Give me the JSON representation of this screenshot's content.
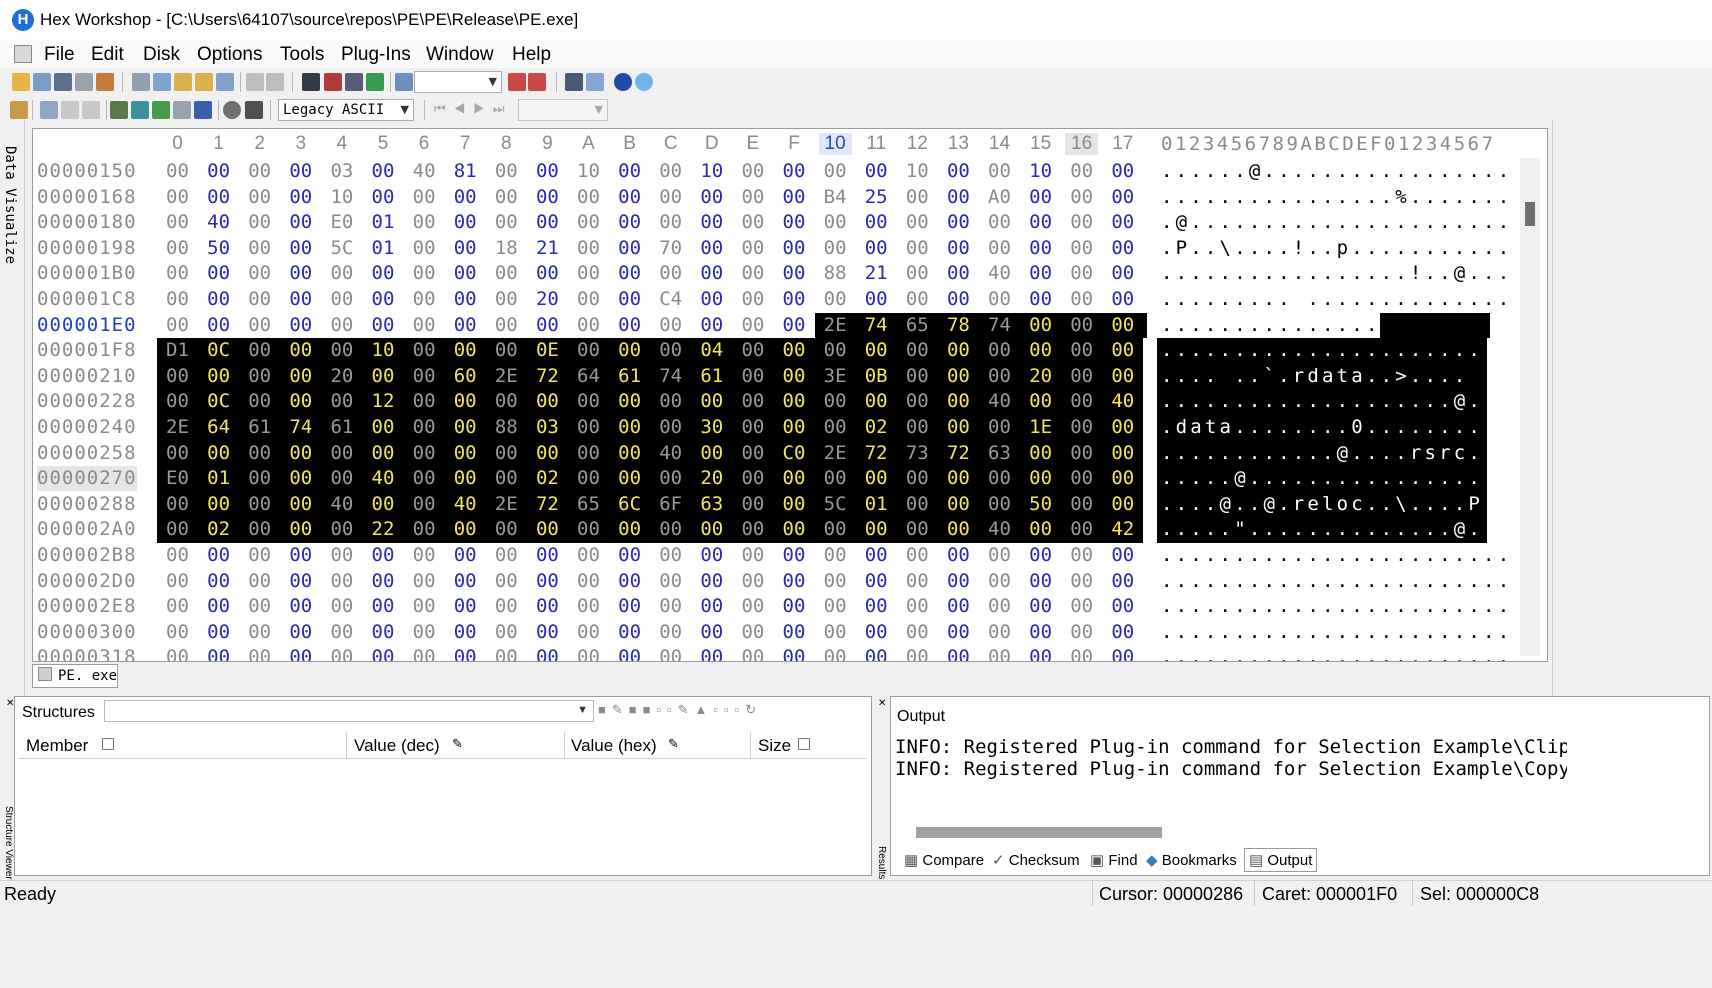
{
  "window": {
    "title": "Hex Workshop - [C:\\Users\\64107\\source\\repos\\PE\\PE\\Release\\PE.exe]",
    "icon": "hex-workshop-logo"
  },
  "menu": [
    "File",
    "Edit",
    "Disk",
    "Options",
    "Tools",
    "Plug-Ins",
    "Window",
    "Help"
  ],
  "toolbar2": {
    "encoding": "Legacy ASCII"
  },
  "side_tabs": {
    "left": "Data Visualize",
    "structure": "Structure Viewer",
    "results": "Results"
  },
  "editor": {
    "columns": [
      "0",
      "1",
      "2",
      "3",
      "4",
      "5",
      "6",
      "7",
      "8",
      "9",
      "A",
      "B",
      "C",
      "D",
      "E",
      "F",
      "10",
      "11",
      "12",
      "13",
      "14",
      "15",
      "16",
      "17"
    ],
    "ascii_header": "0123456789ABCDEF01234567",
    "rows": [
      {
        "addr": "00000150",
        "bytes": [
          "00",
          "00",
          "00",
          "00",
          "03",
          "00",
          "40",
          "81",
          "00",
          "00",
          "10",
          "00",
          "00",
          "10",
          "00",
          "00",
          "00",
          "00",
          "10",
          "00",
          "00",
          "10",
          "00",
          "00"
        ],
        "ascii": "......@................."
      },
      {
        "addr": "00000168",
        "bytes": [
          "00",
          "00",
          "00",
          "00",
          "10",
          "00",
          "00",
          "00",
          "00",
          "00",
          "00",
          "00",
          "00",
          "00",
          "00",
          "00",
          "B4",
          "25",
          "00",
          "00",
          "A0",
          "00",
          "00",
          "00"
        ],
        "ascii": "................%......."
      },
      {
        "addr": "00000180",
        "bytes": [
          "00",
          "40",
          "00",
          "00",
          "E0",
          "01",
          "00",
          "00",
          "00",
          "00",
          "00",
          "00",
          "00",
          "00",
          "00",
          "00",
          "00",
          "00",
          "00",
          "00",
          "00",
          "00",
          "00",
          "00"
        ],
        "ascii": ".@......................"
      },
      {
        "addr": "00000198",
        "bytes": [
          "00",
          "50",
          "00",
          "00",
          "5C",
          "01",
          "00",
          "00",
          "18",
          "21",
          "00",
          "00",
          "70",
          "00",
          "00",
          "00",
          "00",
          "00",
          "00",
          "00",
          "00",
          "00",
          "00",
          "00"
        ],
        "ascii": ".P..\\....!..p..........."
      },
      {
        "addr": "000001B0",
        "bytes": [
          "00",
          "00",
          "00",
          "00",
          "00",
          "00",
          "00",
          "00",
          "00",
          "00",
          "00",
          "00",
          "00",
          "00",
          "00",
          "00",
          "88",
          "21",
          "00",
          "00",
          "40",
          "00",
          "00",
          "00"
        ],
        "ascii": ".................!..@..."
      },
      {
        "addr": "000001C8",
        "bytes": [
          "00",
          "00",
          "00",
          "00",
          "00",
          "00",
          "00",
          "00",
          "00",
          "20",
          "00",
          "00",
          "C4",
          "00",
          "00",
          "00",
          "00",
          "00",
          "00",
          "00",
          "00",
          "00",
          "00",
          "00"
        ],
        "ascii": "......... .............."
      },
      {
        "addr": "000001E0",
        "bytes": [
          "00",
          "00",
          "00",
          "00",
          "00",
          "00",
          "00",
          "00",
          "00",
          "00",
          "00",
          "00",
          "00",
          "00",
          "00",
          "00",
          "2E",
          "74",
          "65",
          "78",
          "74",
          "00",
          "00",
          "00"
        ],
        "ascii": "................text..."
      },
      {
        "addr": "000001F8",
        "bytes": [
          "D1",
          "0C",
          "00",
          "00",
          "00",
          "10",
          "00",
          "00",
          "00",
          "0E",
          "00",
          "00",
          "00",
          "04",
          "00",
          "00",
          "00",
          "00",
          "00",
          "00",
          "00",
          "00",
          "00",
          "00"
        ],
        "ascii": "........................"
      },
      {
        "addr": "00000210",
        "bytes": [
          "00",
          "00",
          "00",
          "00",
          "20",
          "00",
          "00",
          "60",
          "2E",
          "72",
          "64",
          "61",
          "74",
          "61",
          "00",
          "00",
          "3E",
          "0B",
          "00",
          "00",
          "00",
          "20",
          "00",
          "00"
        ],
        "ascii": ".... ..`.rdata..>.... .."
      },
      {
        "addr": "00000228",
        "bytes": [
          "00",
          "0C",
          "00",
          "00",
          "00",
          "12",
          "00",
          "00",
          "00",
          "00",
          "00",
          "00",
          "00",
          "00",
          "00",
          "00",
          "00",
          "00",
          "00",
          "00",
          "40",
          "00",
          "00",
          "40"
        ],
        "ascii": "....................@..@"
      },
      {
        "addr": "00000240",
        "bytes": [
          "2E",
          "64",
          "61",
          "74",
          "61",
          "00",
          "00",
          "00",
          "88",
          "03",
          "00",
          "00",
          "00",
          "30",
          "00",
          "00",
          "00",
          "02",
          "00",
          "00",
          "00",
          "1E",
          "00",
          "00"
        ],
        "ascii": ".data........0.........."
      },
      {
        "addr": "00000258",
        "bytes": [
          "00",
          "00",
          "00",
          "00",
          "00",
          "00",
          "00",
          "00",
          "00",
          "00",
          "00",
          "00",
          "40",
          "00",
          "00",
          "C0",
          "2E",
          "72",
          "73",
          "72",
          "63",
          "00",
          "00",
          "00"
        ],
        "ascii": "............@....rsrc..."
      },
      {
        "addr": "00000270",
        "bytes": [
          "E0",
          "01",
          "00",
          "00",
          "00",
          "40",
          "00",
          "00",
          "00",
          "02",
          "00",
          "00",
          "00",
          "20",
          "00",
          "00",
          "00",
          "00",
          "00",
          "00",
          "00",
          "00",
          "00",
          "00"
        ],
        "ascii": ".....@.................."
      },
      {
        "addr": "00000288",
        "bytes": [
          "00",
          "00",
          "00",
          "00",
          "40",
          "00",
          "00",
          "40",
          "2E",
          "72",
          "65",
          "6C",
          "6F",
          "63",
          "00",
          "00",
          "5C",
          "01",
          "00",
          "00",
          "00",
          "50",
          "00",
          "00"
        ],
        "ascii": "....@..@.reloc..\\....P.."
      },
      {
        "addr": "000002A0",
        "bytes": [
          "00",
          "02",
          "00",
          "00",
          "00",
          "22",
          "00",
          "00",
          "00",
          "00",
          "00",
          "00",
          "00",
          "00",
          "00",
          "00",
          "00",
          "00",
          "00",
          "00",
          "40",
          "00",
          "00",
          "42"
        ],
        "ascii": ".....\"..............@..B"
      },
      {
        "addr": "000002B8",
        "bytes": [
          "00",
          "00",
          "00",
          "00",
          "00",
          "00",
          "00",
          "00",
          "00",
          "00",
          "00",
          "00",
          "00",
          "00",
          "00",
          "00",
          "00",
          "00",
          "00",
          "00",
          "00",
          "00",
          "00",
          "00"
        ],
        "ascii": "........................"
      },
      {
        "addr": "000002D0",
        "bytes": [
          "00",
          "00",
          "00",
          "00",
          "00",
          "00",
          "00",
          "00",
          "00",
          "00",
          "00",
          "00",
          "00",
          "00",
          "00",
          "00",
          "00",
          "00",
          "00",
          "00",
          "00",
          "00",
          "00",
          "00"
        ],
        "ascii": "........................"
      },
      {
        "addr": "000002E8",
        "bytes": [
          "00",
          "00",
          "00",
          "00",
          "00",
          "00",
          "00",
          "00",
          "00",
          "00",
          "00",
          "00",
          "00",
          "00",
          "00",
          "00",
          "00",
          "00",
          "00",
          "00",
          "00",
          "00",
          "00",
          "00"
        ],
        "ascii": "........................"
      },
      {
        "addr": "00000300",
        "bytes": [
          "00",
          "00",
          "00",
          "00",
          "00",
          "00",
          "00",
          "00",
          "00",
          "00",
          "00",
          "00",
          "00",
          "00",
          "00",
          "00",
          "00",
          "00",
          "00",
          "00",
          "00",
          "00",
          "00",
          "00"
        ],
        "ascii": "........................"
      },
      {
        "addr": "00000318",
        "bytes": [
          "00",
          "00",
          "00",
          "00",
          "00",
          "00",
          "00",
          "00",
          "00",
          "00",
          "00",
          "00",
          "00",
          "00",
          "00",
          "00",
          "00",
          "00",
          "00",
          "00",
          "00",
          "00",
          "00",
          "00"
        ],
        "ascii": "........................"
      }
    ],
    "doc_tab": "PE. exe"
  },
  "structures": {
    "title": "Structures",
    "columns": [
      "Member",
      "Value (dec)",
      "Value (hex)",
      "Size"
    ]
  },
  "output": {
    "title": "Output",
    "lines": [
      "INFO: Registered Plug-in command for Selection Example\\Clip to",
      "INFO: Registered Plug-in command for Selection Example\\Copy to"
    ],
    "tabs": [
      "Compare",
      "Checksum",
      "Find",
      "Bookmarks",
      "Output"
    ]
  },
  "status": {
    "ready": "Ready",
    "cursor": "Cursor: 00000286",
    "caret": "Caret: 000001F0",
    "sel": "Sel: 000000C8"
  }
}
